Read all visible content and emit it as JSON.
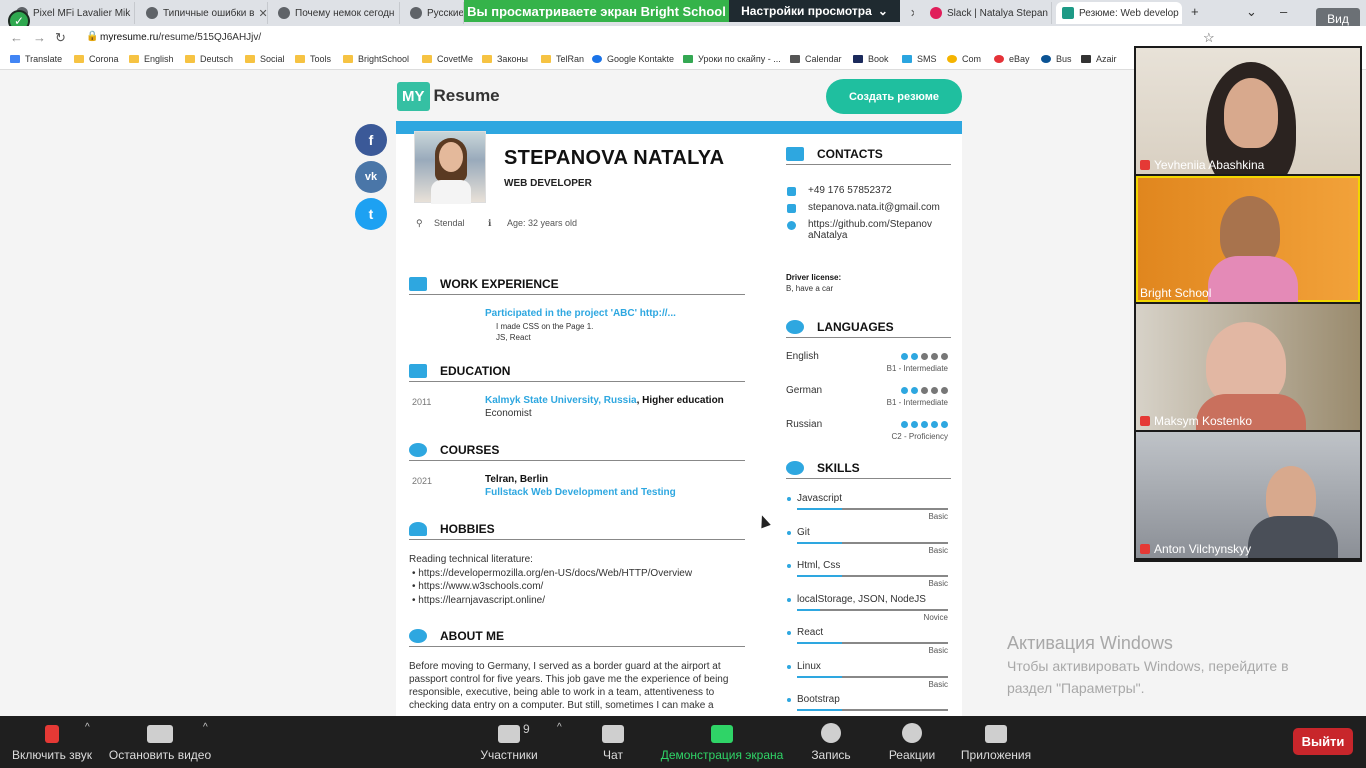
{
  "browser": {
    "tabs": [
      {
        "label": "Pixel MFi Lavalier Mik"
      },
      {
        "label": "Типичные ошибки в"
      },
      {
        "label": "Почему немок сегодн"
      },
      {
        "label": "Русские пс"
      },
      {
        "label": "Slack | Natalya Stepan"
      },
      {
        "label": "Резюме: Web develop"
      }
    ],
    "url_host": "myresume.ru",
    "url_path": "/resume/515QJ6AHJjv/",
    "new_tab": "+",
    "bookmarks": [
      "Translate",
      "Corona",
      "English",
      "Deutsch",
      "Social",
      "Tools",
      "BrightSchool",
      "CovetMe",
      "Законы",
      "TelRan",
      "Google Kontakte",
      "Уроки по скайпу - ...",
      "Calendar",
      "Book",
      "SMS",
      "Com",
      "eBay",
      "Bus",
      "Azair"
    ]
  },
  "zoom_share": {
    "banner": "Вы просматриваете экран Bright School",
    "view_options": "Настройки просмотра",
    "view_label": "Вид"
  },
  "site": {
    "logo_my": "MY",
    "logo_resume": "Resume",
    "cta": "Создать резюме",
    "social": [
      {
        "name": "facebook",
        "glyph": "f",
        "color": "#3b5998"
      },
      {
        "name": "vk",
        "glyph": "vk",
        "color": "#4a76a8"
      },
      {
        "name": "twitter",
        "glyph": "t",
        "color": "#1da1f2"
      }
    ]
  },
  "resume": {
    "name": "STEPANOVA NATALYA",
    "role": "WEB DEVELOPER",
    "city": "Stendal",
    "age": "Age: 32 years old",
    "sections": {
      "work": "WORK EXPERIENCE",
      "education": "EDUCATION",
      "courses": "COURSES",
      "hobbies": "HOBBIES",
      "about": "ABOUT ME",
      "contacts": "CONTACTS",
      "languages": "LANGUAGES",
      "skills": "SKILLS"
    },
    "work": {
      "title": "Participated in the project 'ABC' http://...",
      "line1": "I made CSS on the Page 1.",
      "line2": "JS, React"
    },
    "education": {
      "year": "2011",
      "school": "Kalmyk State University, Russia",
      "degree": ", Higher education",
      "field": "Economist"
    },
    "courses": {
      "year": "2021",
      "org": "Telran, Berlin",
      "title": "Fullstack Web Development and Testing"
    },
    "hobbies": {
      "intro": "Reading technical literature:",
      "items": [
        "• https://developermozilla.org/en-US/docs/Web/HTTP/Overview",
        "• https://www.w3schools.com/",
        "• https://learnjavascript.online/"
      ]
    },
    "about": [
      "Before moving to Germany, I served as a border guard at the airport at",
      "passport control for five years. This job gave me the experience of being",
      "responsible, executive, being able to work in a team, attentiveness to",
      "checking data entry on a computer. But still, sometimes I can make a"
    ],
    "contacts": {
      "phone": "+49 176 57852372",
      "email": "stepanova.nata.it@gmail.com",
      "github1": "https://github.com/Stepanov",
      "github2": "aNatalya",
      "license_label": "Driver license:",
      "license_value": "B, have a car"
    },
    "languages": [
      {
        "name": "English",
        "level": "B1 - Intermediate",
        "dots": 2
      },
      {
        "name": "German",
        "level": "B1 - Intermediate",
        "dots": 2
      },
      {
        "name": "Russian",
        "level": "C2 - Proficiency",
        "dots": 5
      }
    ],
    "skills": [
      {
        "name": "Javascript",
        "level": "Basic",
        "fill": 0.3
      },
      {
        "name": "Git",
        "level": "Basic",
        "fill": 0.3
      },
      {
        "name": "Html, Css",
        "level": "Basic",
        "fill": 0.3
      },
      {
        "name": "localStorage, JSON, NodeJS",
        "level": "Novice",
        "fill": 0.15
      },
      {
        "name": "React",
        "level": "Basic",
        "fill": 0.3
      },
      {
        "name": "Linux",
        "level": "Basic",
        "fill": 0.3
      },
      {
        "name": "Bootstrap",
        "level": "",
        "fill": 0.3
      }
    ]
  },
  "windows_activation": {
    "title": "Активация Windows",
    "line1": "Чтобы активировать Windows, перейдите в",
    "line2": "раздел \"Параметры\"."
  },
  "participants": [
    {
      "name": "Yevheniia Abashkina",
      "muted": true
    },
    {
      "name": "Bright School",
      "muted": false
    },
    {
      "name": "Maksym Kostenko",
      "muted": true
    },
    {
      "name": "Anton Vilchynskyy",
      "muted": true
    }
  ],
  "toolbar": {
    "unmute": "Включить звук",
    "stop_video": "Остановить видео",
    "participants": "Участники",
    "participants_count": "9",
    "chat": "Чат",
    "share": "Демонстрация экрана",
    "record": "Запись",
    "reactions": "Реакции",
    "apps": "Приложения",
    "leave": "Выйти"
  }
}
